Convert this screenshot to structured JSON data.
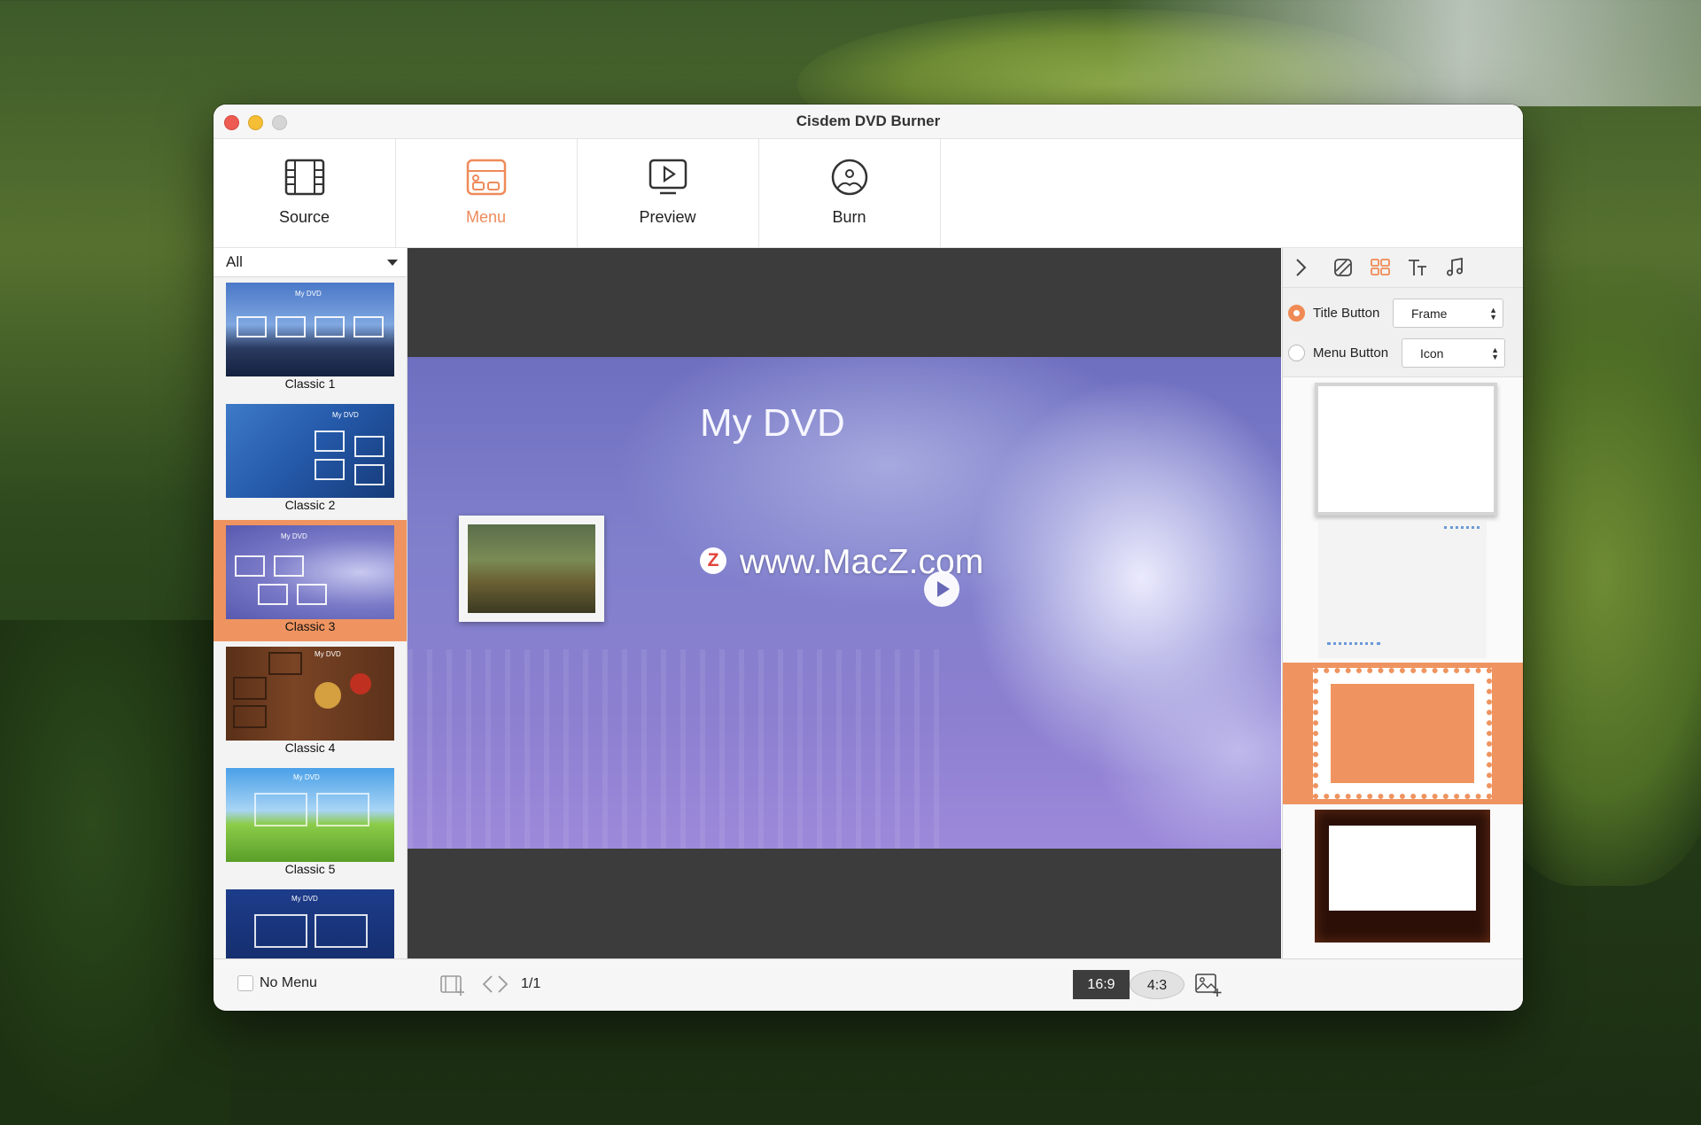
{
  "window": {
    "title": "Cisdem DVD Burner"
  },
  "toolbar": {
    "source": "Source",
    "menu": "Menu",
    "preview": "Preview",
    "burn": "Burn",
    "active": "menu",
    "accent_color": "#ee8a5a"
  },
  "left_panel": {
    "filter": "All",
    "templates": [
      {
        "name": "Classic 1",
        "thumb_text": "My DVD"
      },
      {
        "name": "Classic 2",
        "thumb_text": "My DVD"
      },
      {
        "name": "Classic 3",
        "thumb_text": "My DVD",
        "selected": true
      },
      {
        "name": "Classic 4",
        "thumb_text": "My DVD"
      },
      {
        "name": "Classic 5",
        "thumb_text": "My DVD"
      },
      {
        "name": "",
        "thumb_text": "My DVD"
      }
    ]
  },
  "canvas": {
    "dvd_title": "My DVD",
    "watermark": "www.MacZ.com",
    "watermark_badge": "Z"
  },
  "right_panel": {
    "tabs": [
      "collapse-icon",
      "background-icon",
      "layout-icon",
      "text-icon",
      "music-icon"
    ],
    "title_button": {
      "label": "Title Button",
      "value": "Frame",
      "checked": true
    },
    "menu_button": {
      "label": "Menu Button",
      "value": "Icon",
      "checked": false
    },
    "frames": [
      "frame-plain",
      "frame-dotted",
      "frame-stamp",
      "frame-dark"
    ],
    "selected_frame": 2
  },
  "bottom_bar": {
    "no_menu": "No Menu",
    "page": "1/1",
    "ratio_169": "16:9",
    "ratio_43": "4:3",
    "selected_ratio": "16:9"
  }
}
